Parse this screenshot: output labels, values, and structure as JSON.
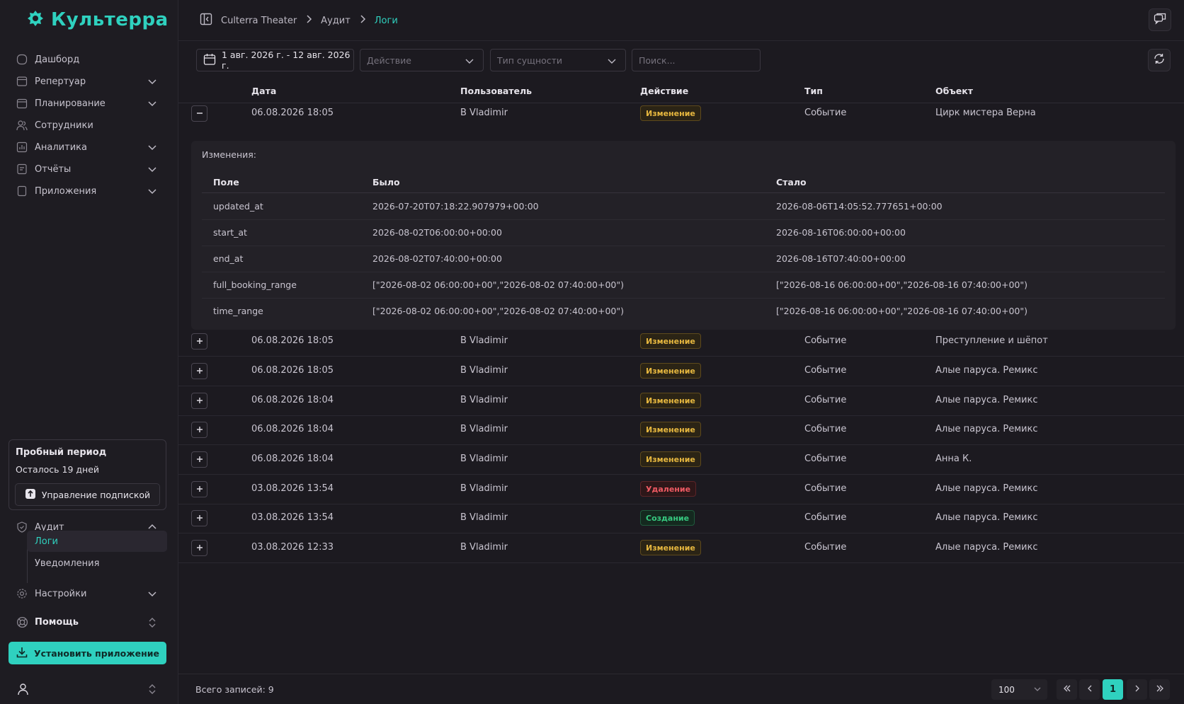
{
  "brand": {
    "name": "Культерра",
    "accent": "#2fd1bf"
  },
  "sidebar": {
    "items": [
      {
        "label": "Дашборд",
        "icon": "home-icon",
        "expandable": false
      },
      {
        "label": "Репертуар",
        "icon": "theater-icon",
        "expandable": true
      },
      {
        "label": "Планирование",
        "icon": "calendar-icon",
        "expandable": true
      },
      {
        "label": "Сотрудники",
        "icon": "users-icon",
        "expandable": false
      },
      {
        "label": "Аналитика",
        "icon": "chart-icon",
        "expandable": true
      },
      {
        "label": "Отчёты",
        "icon": "report-icon",
        "expandable": true
      },
      {
        "label": "Приложения",
        "icon": "apps-icon",
        "expandable": true
      }
    ],
    "trial": {
      "title": "Пробный период",
      "days_left": "Осталось 19 дней",
      "manage_button": "Управление подпиской"
    },
    "audit": {
      "label": "Аудит",
      "sub_items": [
        {
          "label": "Логи",
          "active": true
        },
        {
          "label": "Уведомления",
          "active": false
        }
      ]
    },
    "settings_label": "Настройки",
    "help_label": "Помощь",
    "install_button": "Установить приложение"
  },
  "breadcrumb": {
    "items": [
      "Culterra Theater",
      "Аудит",
      "Логи"
    ]
  },
  "filters": {
    "date_range": "1 авг. 2026 г. - 12 авг. 2026 г.",
    "action_placeholder": "Действие",
    "entity_type_placeholder": "Тип сущности",
    "search_placeholder": "Поиск..."
  },
  "table": {
    "columns": [
      "Дата",
      "Пользователь",
      "Действие",
      "Тип",
      "Объект"
    ],
    "rows": [
      {
        "date": "06.08.2026 18:05",
        "user": "B Vladimir",
        "action": "Изменение",
        "action_kind": "change",
        "type": "Событие",
        "object": "Цирк мистера Верна",
        "expanded": true
      },
      {
        "date": "06.08.2026 18:05",
        "user": "B Vladimir",
        "action": "Изменение",
        "action_kind": "change",
        "type": "Событие",
        "object": "Преступление и шёпот",
        "expanded": false
      },
      {
        "date": "06.08.2026 18:05",
        "user": "B Vladimir",
        "action": "Изменение",
        "action_kind": "change",
        "type": "Событие",
        "object": "Алые паруса. Ремикс",
        "expanded": false
      },
      {
        "date": "06.08.2026 18:04",
        "user": "B Vladimir",
        "action": "Изменение",
        "action_kind": "change",
        "type": "Событие",
        "object": "Алые паруса. Ремикс",
        "expanded": false
      },
      {
        "date": "06.08.2026 18:04",
        "user": "B Vladimir",
        "action": "Изменение",
        "action_kind": "change",
        "type": "Событие",
        "object": "Алые паруса. Ремикс",
        "expanded": false
      },
      {
        "date": "06.08.2026 18:04",
        "user": "B Vladimir",
        "action": "Изменение",
        "action_kind": "change",
        "type": "Событие",
        "object": "Анна К.",
        "expanded": false
      },
      {
        "date": "03.08.2026 13:54",
        "user": "B Vladimir",
        "action": "Удаление",
        "action_kind": "delete",
        "type": "Событие",
        "object": "Алые паруса. Ремикс",
        "expanded": false
      },
      {
        "date": "03.08.2026 13:54",
        "user": "B Vladimir",
        "action": "Создание",
        "action_kind": "create",
        "type": "Событие",
        "object": "Алые паруса. Ремикс",
        "expanded": false
      },
      {
        "date": "03.08.2026 12:33",
        "user": "B Vladimir",
        "action": "Изменение",
        "action_kind": "change",
        "type": "Событие",
        "object": "Алые паруса. Ремикс",
        "expanded": false
      }
    ]
  },
  "details": {
    "title": "Изменения:",
    "columns": [
      "Поле",
      "Было",
      "Стало"
    ],
    "rows": [
      {
        "field": "updated_at",
        "before": "2026-07-20T07:18:22.907979+00:00",
        "after": "2026-08-06T14:05:52.777651+00:00"
      },
      {
        "field": "start_at",
        "before": "2026-08-02T06:00:00+00:00",
        "after": "2026-08-16T06:00:00+00:00"
      },
      {
        "field": "end_at",
        "before": "2026-08-02T07:40:00+00:00",
        "after": "2026-08-16T07:40:00+00:00"
      },
      {
        "field": "full_booking_range",
        "before": "[\"2026-08-02 06:00:00+00\",\"2026-08-02 07:40:00+00\")",
        "after": "[\"2026-08-16 06:00:00+00\",\"2026-08-16 07:40:00+00\")"
      },
      {
        "field": "time_range",
        "before": "[\"2026-08-02 06:00:00+00\",\"2026-08-02 07:40:00+00\")",
        "after": "[\"2026-08-16 06:00:00+00\",\"2026-08-16 07:40:00+00\")"
      }
    ]
  },
  "footer": {
    "total": "Всего записей: 9",
    "page_size": "100",
    "current_page": "1"
  }
}
